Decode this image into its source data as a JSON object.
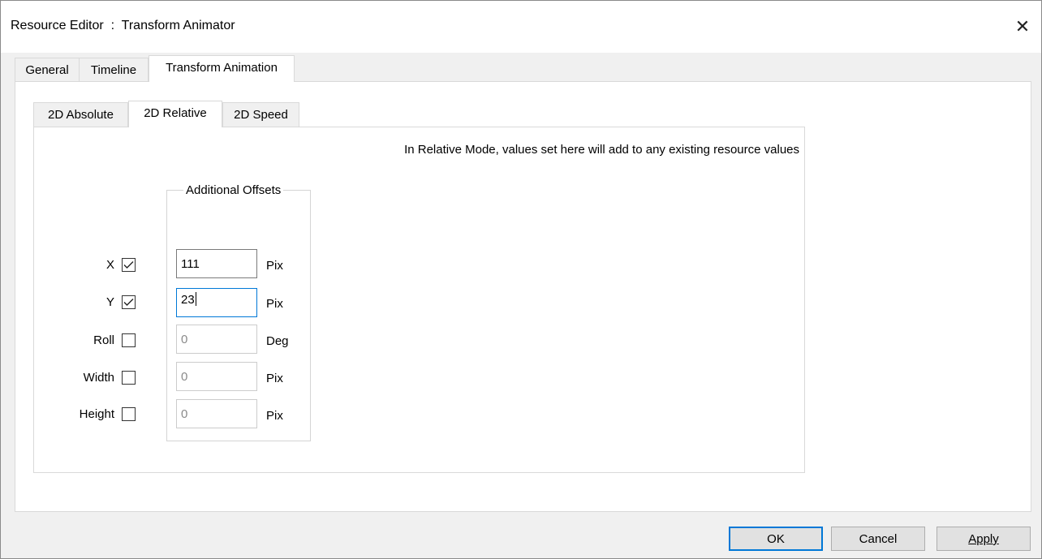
{
  "window": {
    "title": "Resource Editor  :  Transform Animator",
    "close_glyph": "✕"
  },
  "outer_tabs": [
    {
      "label": "General",
      "active": false
    },
    {
      "label": "Timeline",
      "active": false
    },
    {
      "label": "Transform Animation",
      "active": true
    }
  ],
  "inner_tabs": [
    {
      "label": "2D Absolute",
      "active": false
    },
    {
      "label": "2D Relative",
      "active": true
    },
    {
      "label": "2D Speed",
      "active": false
    }
  ],
  "info_text": "In Relative Mode, values set here will add to any existing resource values",
  "group": {
    "legend": "Additional Offsets"
  },
  "rows": [
    {
      "label": "X",
      "checked": true,
      "value": "111",
      "unit": "Pix",
      "enabled": true,
      "focused": false
    },
    {
      "label": "Y",
      "checked": true,
      "value": "23",
      "unit": "Pix",
      "enabled": true,
      "focused": true
    },
    {
      "label": "Roll",
      "checked": false,
      "value": "0",
      "unit": "Deg",
      "enabled": false,
      "focused": false
    },
    {
      "label": "Width",
      "checked": false,
      "value": "0",
      "unit": "Pix",
      "enabled": false,
      "focused": false
    },
    {
      "label": "Height",
      "checked": false,
      "value": "0",
      "unit": "Pix",
      "enabled": false,
      "focused": false
    }
  ],
  "buttons": {
    "ok": "OK",
    "cancel": "Cancel",
    "apply": "Apply"
  },
  "colors": {
    "accent": "#0078d7"
  }
}
